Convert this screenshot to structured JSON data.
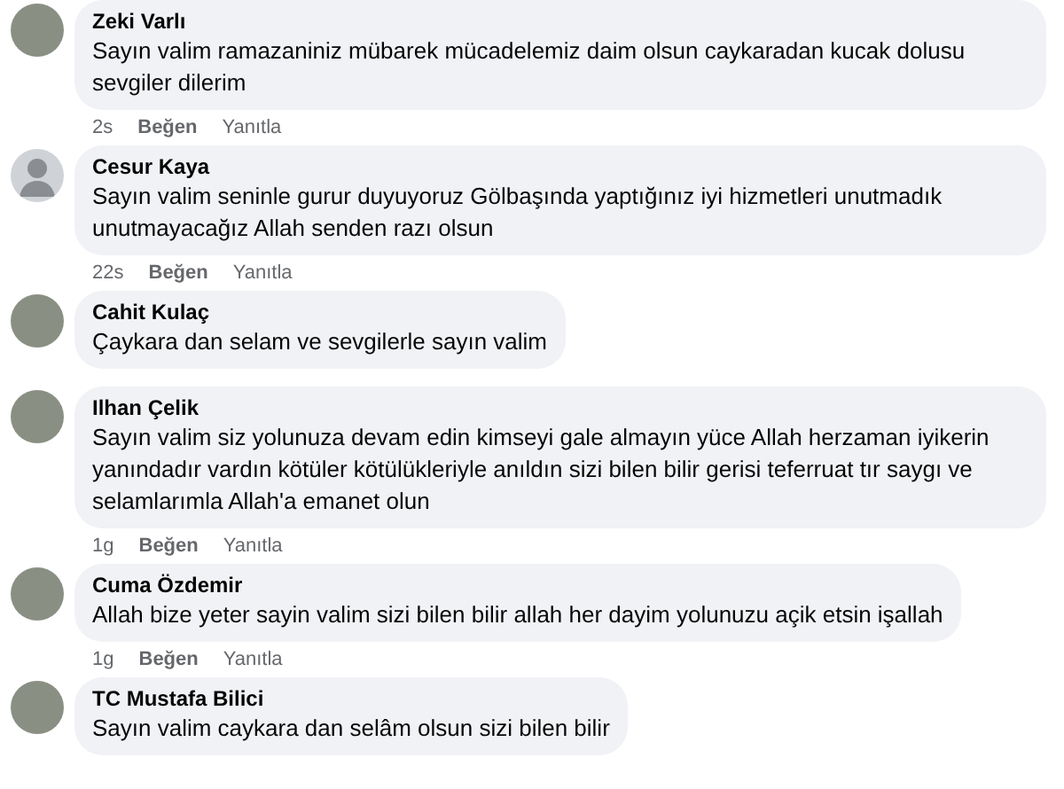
{
  "comments": [
    {
      "author": "Zeki Varlı",
      "kind": "photo",
      "text": "Sayın valim ramazaniniz mübarek mücadelemiz daim olsun caykaradan kucak dolusu sevgiler dilerim",
      "actions": {
        "time": "2s",
        "like": "Beğen",
        "reply": "Yanıtla"
      }
    },
    {
      "author": "Cesur Kaya",
      "kind": "silhouette",
      "text": "Sayın valim seninle gurur duyuyoruz Gölbaşında yaptığınız iyi hizmetleri unutmadık unutmayacağız Allah senden razı olsun",
      "actions": {
        "time": "22s",
        "like": "Beğen",
        "reply": "Yanıtla"
      }
    },
    {
      "author": "Cahit Kulaç",
      "kind": "photo",
      "text": "Çaykara dan selam ve sevgilerle sayın valim"
    },
    {
      "author": "Ilhan Çelik",
      "kind": "photo",
      "text": "Sayın valim siz yolunuza devam edin kimseyi gale almayın yüce Allah herzaman iyikerin yanındadır vardın kötüler kötülükleriyle anıldın sizi bilen bilir gerisi teferruat tır saygı ve selamlarımla Allah'a emanet olun",
      "actions": {
        "time": "1g",
        "like": "Beğen",
        "reply": "Yanıtla"
      }
    },
    {
      "author": "Cuma Özdemir",
      "kind": "photo",
      "text": "Allah bize yeter sayin valim sizi bilen bilir allah her dayim yolunuzu açik etsin işallah",
      "actions": {
        "time": "1g",
        "like": "Beğen",
        "reply": "Yanıtla"
      }
    },
    {
      "author": "TC Mustafa Bilici",
      "kind": "photo",
      "text": "Sayın valim caykara dan selâm olsun sizi bilen bilir"
    }
  ]
}
